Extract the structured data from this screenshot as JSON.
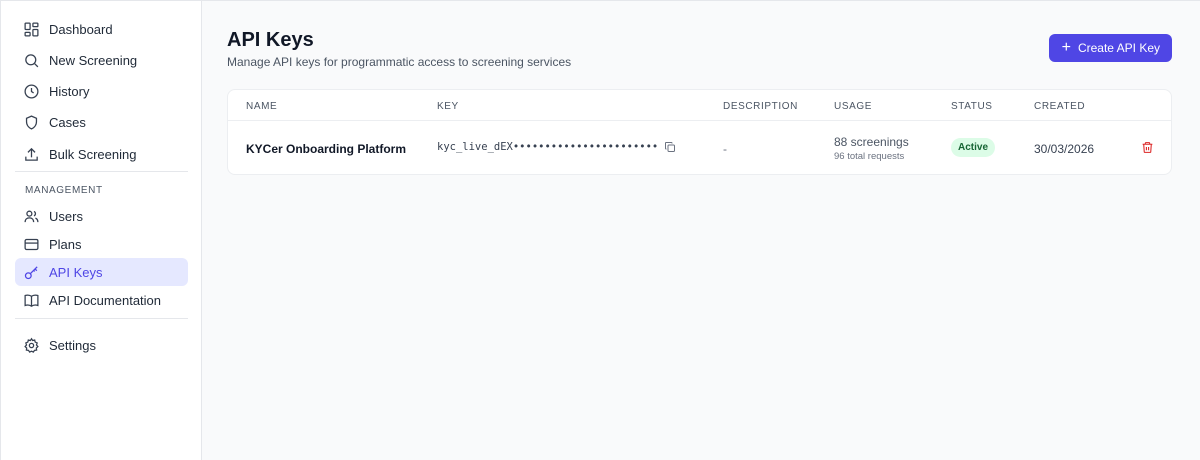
{
  "sidebar": {
    "items": [
      {
        "label": "Dashboard",
        "icon": "dashboard-icon"
      },
      {
        "label": "New Screening",
        "icon": "search-icon"
      },
      {
        "label": "History",
        "icon": "clock-icon"
      },
      {
        "label": "Cases",
        "icon": "shield-icon"
      },
      {
        "label": "Bulk Screening",
        "icon": "upload-icon"
      }
    ],
    "section_label": "MANAGEMENT",
    "management_items": [
      {
        "label": "Users",
        "icon": "users-icon"
      },
      {
        "label": "Plans",
        "icon": "credit-card-icon"
      },
      {
        "label": "API Keys",
        "icon": "key-icon",
        "active": true
      },
      {
        "label": "API Documentation",
        "icon": "book-icon"
      }
    ],
    "settings": {
      "label": "Settings",
      "icon": "gear-icon"
    }
  },
  "header": {
    "title": "API Keys",
    "subtitle": "Manage API keys for programmatic access to screening services",
    "create_button": "Create API Key"
  },
  "table": {
    "columns": [
      "NAME",
      "KEY",
      "DESCRIPTION",
      "USAGE",
      "STATUS",
      "CREATED"
    ],
    "rows": [
      {
        "name": "KYCer Onboarding Platform",
        "key": "kyc_live_dEX•••••••••••••••••••••••",
        "description": "-",
        "usage": "88 screenings",
        "usage_sub": "96 total requests",
        "status": "Active",
        "created": "30/03/2026"
      }
    ]
  },
  "colors": {
    "accent": "#4f46e5",
    "active_bg": "#e5e8ff",
    "status_active_bg": "#dcfce7",
    "status_active_text": "#166534",
    "delete": "#dc2626"
  }
}
